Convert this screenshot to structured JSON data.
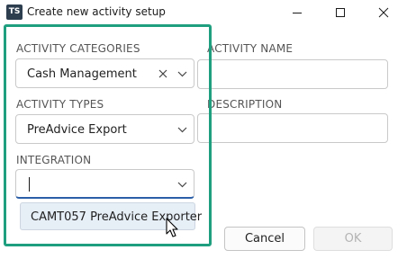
{
  "window": {
    "app_icon_text": "TS",
    "title": "Create new activity setup",
    "controls": [
      "minimize",
      "maximize",
      "close"
    ]
  },
  "form": {
    "activity_categories": {
      "label": "ACTIVITY CATEGORIES",
      "value": "Cash Management"
    },
    "activity_types": {
      "label": "ACTIVITY TYPES",
      "value": "PreAdvice Export"
    },
    "integration": {
      "label": "INTEGRATION",
      "value": "",
      "options": [
        "CAMT057 PreAdvice Exporter"
      ]
    },
    "activity_name": {
      "label": "ACTIVITY NAME",
      "value": ""
    },
    "description": {
      "label": "DESCRIPTION",
      "value": ""
    }
  },
  "buttons": {
    "cancel": "Cancel",
    "ok": "OK"
  },
  "colors": {
    "highlight_border": "#1f9f7f",
    "dropdown_option_bg": "#e6eef6",
    "app_icon_bg": "#2d3e4f"
  }
}
